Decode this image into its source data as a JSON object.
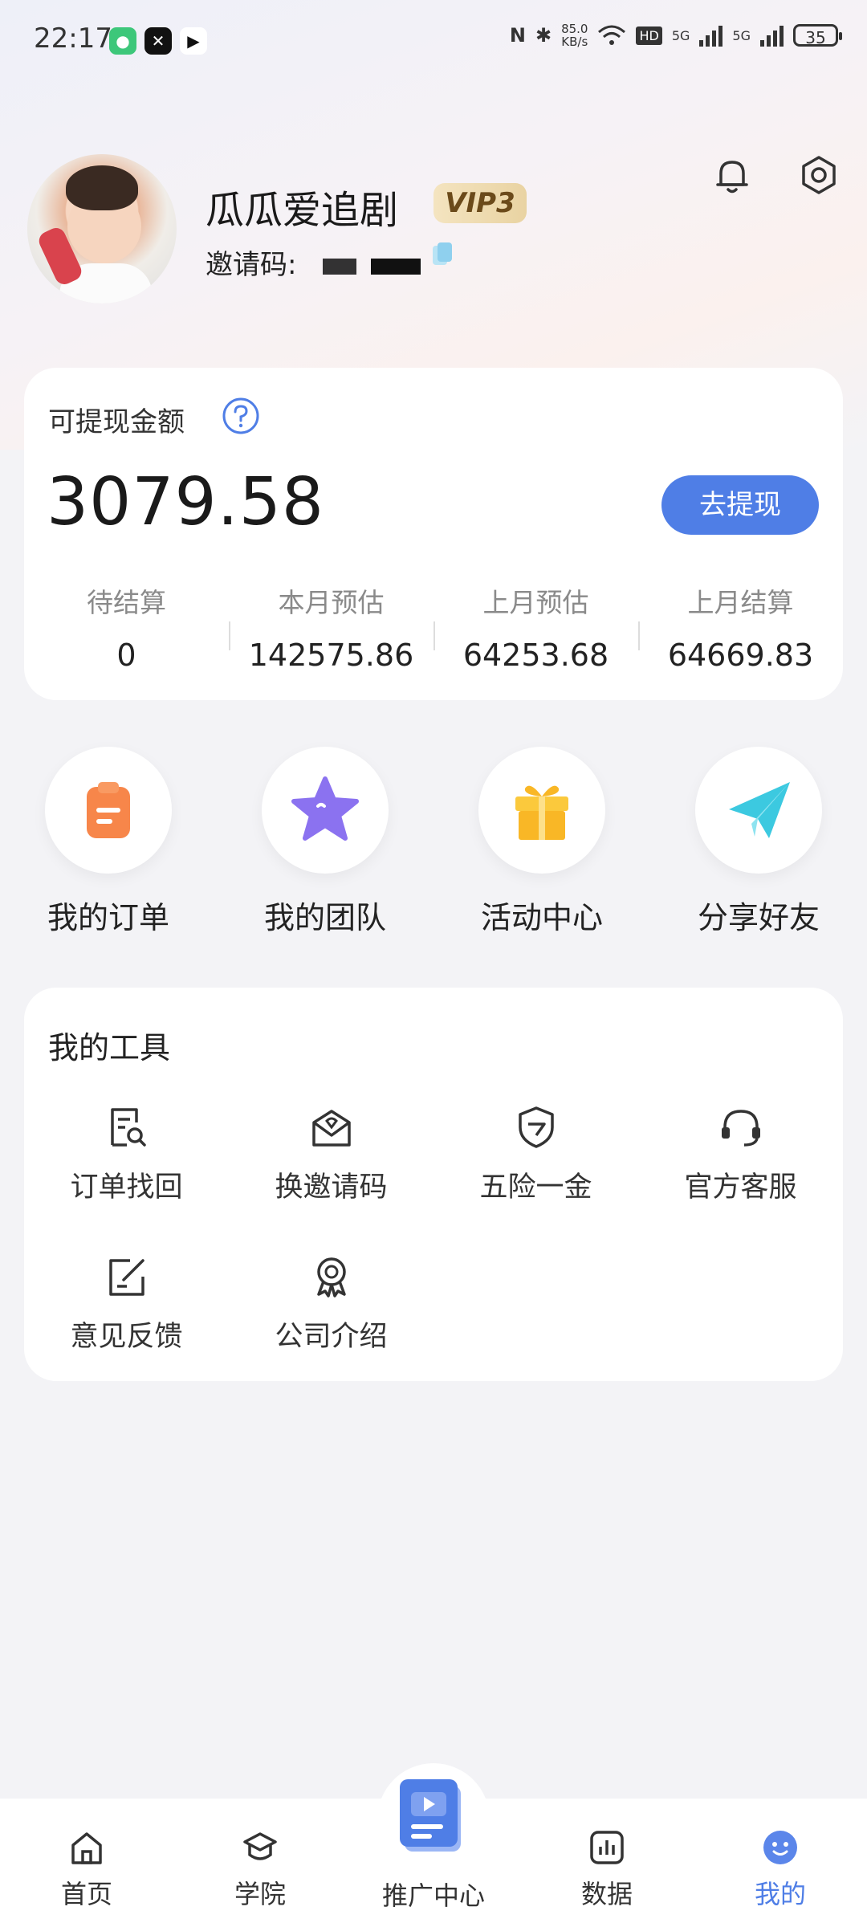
{
  "status_bar": {
    "time": "22:17",
    "net_speed_value": "85.0",
    "net_speed_unit": "KB/s",
    "signal_1": "5G",
    "signal_2": "5G",
    "hd_label": "HD",
    "battery": "35"
  },
  "profile": {
    "nickname": "瓜瓜爱追剧",
    "vip_level": "VIP3",
    "invite_label": "邀请码:"
  },
  "balance": {
    "title": "可提现金额",
    "amount": "3079.58",
    "withdraw_label": "去提现",
    "stats": [
      {
        "label": "待结算",
        "value": "0"
      },
      {
        "label": "本月预估",
        "value": "142575.86"
      },
      {
        "label": "上月预估",
        "value": "64253.68"
      },
      {
        "label": "上月结算",
        "value": "64669.83"
      }
    ]
  },
  "quick_entries": [
    {
      "label": "我的订单",
      "icon": "clipboard-icon",
      "color": "#f7864a"
    },
    {
      "label": "我的团队",
      "icon": "star-icon",
      "color": "#8b72f0"
    },
    {
      "label": "活动中心",
      "icon": "gift-icon",
      "color": "#f9b726"
    },
    {
      "label": "分享好友",
      "icon": "paper-plane-icon",
      "color": "#3cc9e0"
    }
  ],
  "tools": {
    "title": "我的工具",
    "items": [
      {
        "label": "订单找回",
        "icon": "order-search-icon"
      },
      {
        "label": "换邀请码",
        "icon": "envelope-icon"
      },
      {
        "label": "五险一金",
        "icon": "shield-icon"
      },
      {
        "label": "官方客服",
        "icon": "headset-icon"
      },
      {
        "label": "意见反馈",
        "icon": "edit-icon"
      },
      {
        "label": "公司介绍",
        "icon": "award-icon"
      }
    ]
  },
  "tabbar": {
    "items": [
      {
        "label": "首页",
        "icon": "home-icon"
      },
      {
        "label": "学院",
        "icon": "graduation-cap-icon"
      },
      {
        "label": "推广中心",
        "icon": "video-book-icon"
      },
      {
        "label": "数据",
        "icon": "bar-chart-icon"
      },
      {
        "label": "我的",
        "icon": "smiley-icon",
        "active": true
      }
    ]
  },
  "colors": {
    "accent": "#4f7ee6",
    "vip_gold": "#e9d3a2",
    "background": "#f3f3f6"
  }
}
